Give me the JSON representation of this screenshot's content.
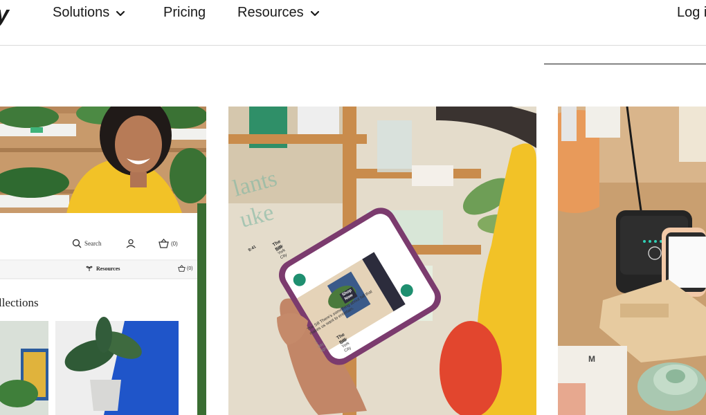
{
  "nav": {
    "logo_fragment": "y",
    "items": [
      {
        "label": "Solutions",
        "has_dropdown": true
      },
      {
        "label": "Pricing",
        "has_dropdown": false
      },
      {
        "label": "Resources",
        "has_dropdown": true
      }
    ],
    "login_label": "Log i"
  },
  "cards": {
    "storefront": {
      "search_label": "Search",
      "cart_count": "(0)",
      "resources_label": "Resources",
      "cart_count_2": "(0)",
      "heading_fragment": "llections"
    },
    "phone": {
      "time": "9:41",
      "shop_name": "The Sill",
      "location": "New York City",
      "shop_now": "Shop Now",
      "caption": "The Sill There's something about fall that makes us want to entertain.",
      "post_time": "1 day ago",
      "shop_name_2": "The Sill",
      "location_2": "New York City"
    },
    "pos": {
      "book_letter": "M"
    }
  },
  "colors": {
    "nav_text": "#1a1a1a",
    "divider": "#d9d9d9",
    "accent_green": "#1f8f70",
    "yellow": "#f2c227",
    "phone_case": "#7b3b6e"
  }
}
